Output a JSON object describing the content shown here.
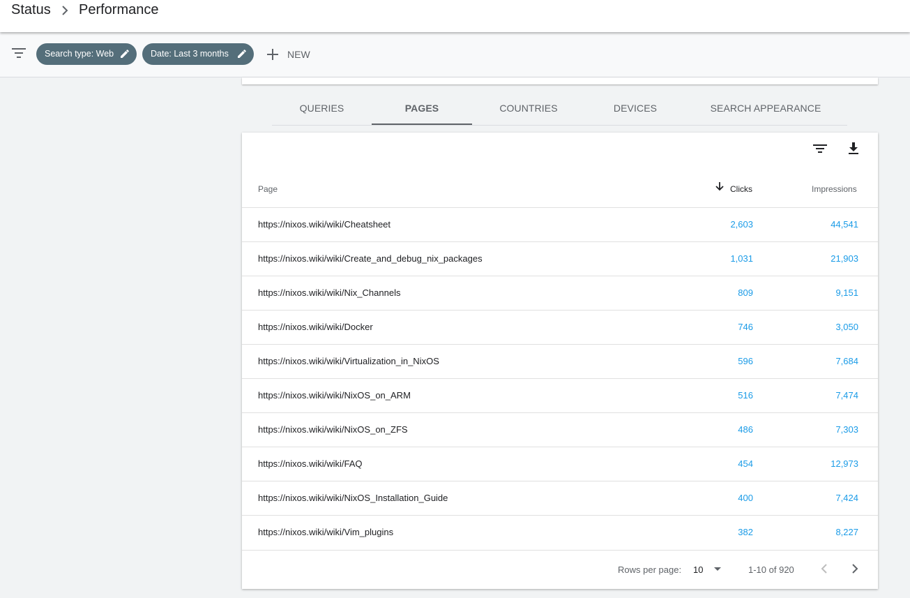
{
  "breadcrumb": {
    "parent": "Status",
    "current": "Performance"
  },
  "filters": {
    "chips": [
      "Search type: Web",
      "Date: Last 3 months"
    ],
    "new_label": "NEW"
  },
  "tabs": [
    {
      "label": "QUERIES",
      "active": false
    },
    {
      "label": "PAGES",
      "active": true
    },
    {
      "label": "COUNTRIES",
      "active": false
    },
    {
      "label": "DEVICES",
      "active": false
    },
    {
      "label": "SEARCH APPEARANCE",
      "active": false
    }
  ],
  "table": {
    "columns": {
      "page": "Page",
      "clicks": "Clicks",
      "impressions": "Impressions"
    },
    "sort": "clicks-desc",
    "rows": [
      {
        "page": "https://nixos.wiki/wiki/Cheatsheet",
        "clicks": "2,603",
        "impressions": "44,541"
      },
      {
        "page": "https://nixos.wiki/wiki/Create_and_debug_nix_packages",
        "clicks": "1,031",
        "impressions": "21,903"
      },
      {
        "page": "https://nixos.wiki/wiki/Nix_Channels",
        "clicks": "809",
        "impressions": "9,151"
      },
      {
        "page": "https://nixos.wiki/wiki/Docker",
        "clicks": "746",
        "impressions": "3,050"
      },
      {
        "page": "https://nixos.wiki/wiki/Virtualization_in_NixOS",
        "clicks": "596",
        "impressions": "7,684"
      },
      {
        "page": "https://nixos.wiki/wiki/NixOS_on_ARM",
        "clicks": "516",
        "impressions": "7,474"
      },
      {
        "page": "https://nixos.wiki/wiki/NixOS_on_ZFS",
        "clicks": "486",
        "impressions": "7,303"
      },
      {
        "page": "https://nixos.wiki/wiki/FAQ",
        "clicks": "454",
        "impressions": "12,973"
      },
      {
        "page": "https://nixos.wiki/wiki/NixOS_Installation_Guide",
        "clicks": "400",
        "impressions": "7,424"
      },
      {
        "page": "https://nixos.wiki/wiki/Vim_plugins",
        "clicks": "382",
        "impressions": "8,227"
      }
    ]
  },
  "pagination": {
    "rows_per_page_label": "Rows per page:",
    "rows_per_page": "10",
    "range": "1-10 of 920"
  },
  "colors": {
    "chip": "#546e7a",
    "link_value": "#1a9be7"
  }
}
